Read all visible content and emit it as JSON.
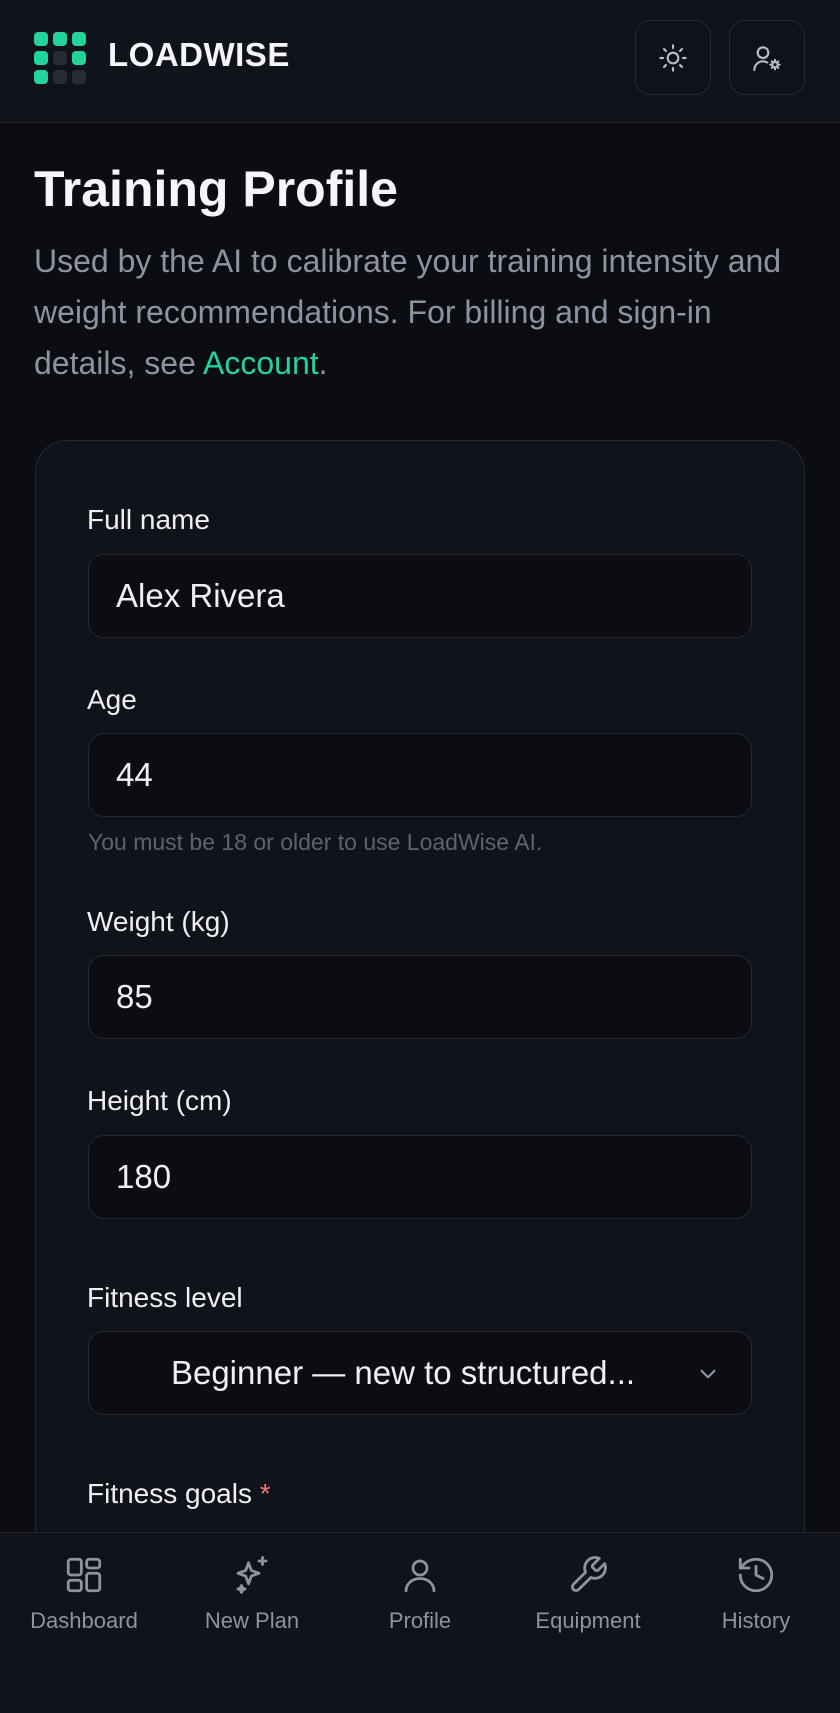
{
  "header": {
    "brand": "LOADWISE",
    "theme_toggle_icon": "sun-icon",
    "account_icon": "user-gear-icon"
  },
  "page": {
    "title": "Training Profile",
    "subtitle_before_link": "Used by the AI to calibrate your training intensity and weight recommendations. For billing and sign-in details, see ",
    "subtitle_link": "Account",
    "subtitle_after_link": "."
  },
  "form": {
    "full_name": {
      "label": "Full name",
      "value": "Alex Rivera"
    },
    "age": {
      "label": "Age",
      "value": "44",
      "hint": "You must be 18 or older to use LoadWise AI."
    },
    "weight": {
      "label": "Weight (kg)",
      "value": "85"
    },
    "height": {
      "label": "Height (cm)",
      "value": "180"
    },
    "fitness_level": {
      "label": "Fitness level",
      "value": "Beginner — new to structured..."
    },
    "fitness_goals": {
      "label": "Fitness goals",
      "required_mark": "*"
    }
  },
  "nav": {
    "items": [
      {
        "label": "Dashboard",
        "icon": "dashboard-grid-icon"
      },
      {
        "label": "New Plan",
        "icon": "sparkles-icon"
      },
      {
        "label": "Profile",
        "icon": "user-icon"
      },
      {
        "label": "Equipment",
        "icon": "wrench-icon"
      },
      {
        "label": "History",
        "icon": "history-icon"
      }
    ]
  },
  "colors": {
    "accent": "#22d39a",
    "background": "#0b0d12",
    "surface": "#10131a",
    "muted_text": "#8d93a1",
    "required": "#f07575"
  }
}
